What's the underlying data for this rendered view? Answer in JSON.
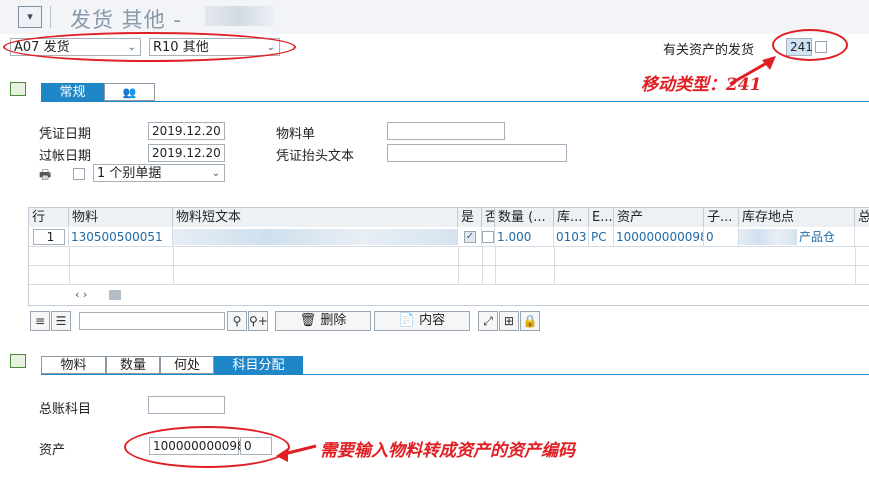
{
  "header": {
    "title": "发货 其他 -",
    "movement_group": "A07 发货",
    "ref_type": "R10 其他",
    "asset_mvt_label": "有关资产的发货",
    "movement_type": "241",
    "annotation_mvt": "移动类型：241"
  },
  "tabs_top": [
    {
      "label": "常规"
    },
    {
      "label": ""
    }
  ],
  "general": {
    "doc_date_label": "凭证日期",
    "doc_date": "2019.12.20",
    "post_date_label": "过帐日期",
    "post_date": "2019.12.20",
    "material_slip_label": "物料单",
    "header_text_label": "凭证抬头文本",
    "print_option": "1 个别单据"
  },
  "table": {
    "columns": [
      "行",
      "物料",
      "物料短文本",
      "是",
      "否",
      "数量 (...",
      "库...",
      "E...",
      "资产",
      "子...",
      "库存地点",
      "总"
    ],
    "rows": [
      {
        "line": "1",
        "material": "130500500051",
        "quantity": "1.000",
        "plant": "0103",
        "unit": "PC",
        "asset": "100000000098",
        "sub": "0",
        "storage": "产品仓"
      }
    ],
    "scroll_hint": "‹ ›"
  },
  "toolbar": {
    "delete_label": "删除",
    "content_label": "内容"
  },
  "tabs_detail": [
    {
      "label": "物料"
    },
    {
      "label": "数量"
    },
    {
      "label": "何处"
    },
    {
      "label": "科目分配"
    }
  ],
  "account": {
    "gl_label": "总账科目",
    "asset_label": "资产",
    "asset_value": "100000000098",
    "asset_sub": "0",
    "annotation_asset": "需要输入物料转成资产的资产编码"
  },
  "colors": {
    "accent": "#1f87c8",
    "annotation": "#e01f25"
  }
}
